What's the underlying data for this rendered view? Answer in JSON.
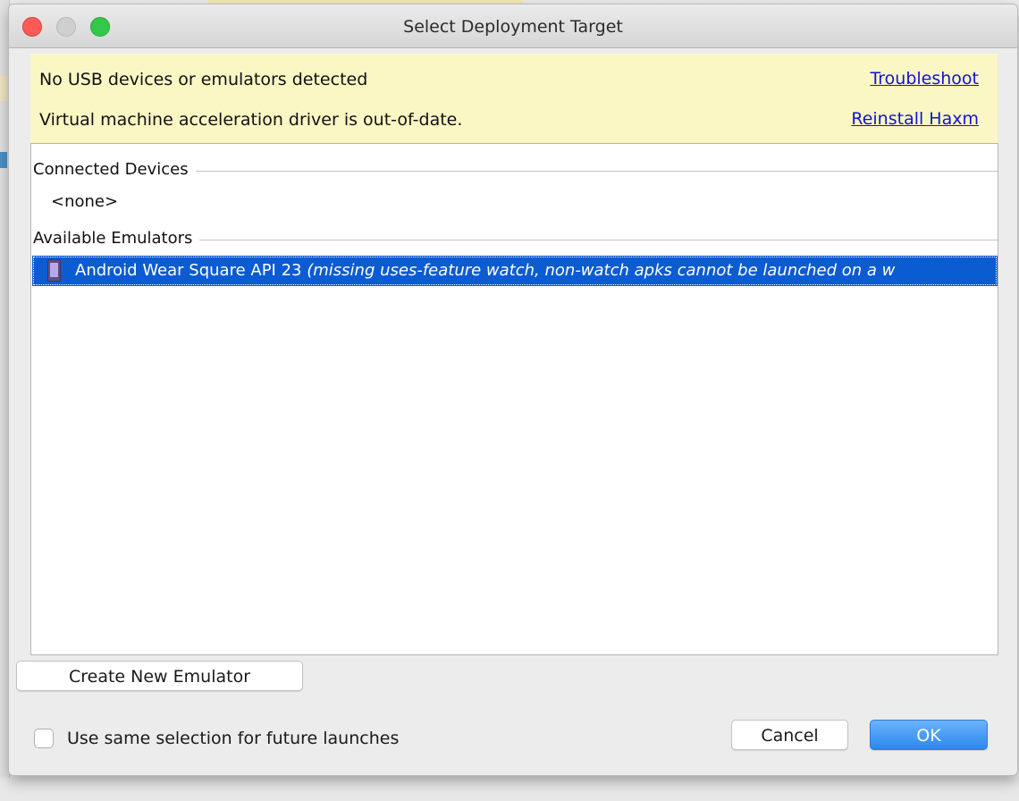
{
  "window": {
    "title": "Select Deployment Target"
  },
  "banner": {
    "messages": [
      {
        "text": "No USB devices or emulators detected",
        "link": "Troubleshoot"
      },
      {
        "text": "Virtual machine acceleration driver is out-of-date.",
        "link": "Reinstall Haxm"
      }
    ]
  },
  "device_list": {
    "groups": [
      {
        "label": "Connected Devices",
        "empty_text": "<none>"
      },
      {
        "label": "Available Emulators",
        "items": [
          {
            "name": "Android Wear Square API 23",
            "note": "(missing uses-feature watch, non-watch apks cannot be launched on a w",
            "icon": "watch-device-icon",
            "selected": true
          }
        ]
      }
    ]
  },
  "buttons": {
    "create": "Create New Emulator",
    "cancel": "Cancel",
    "ok": "OK"
  },
  "checkbox": {
    "label": "Use same selection for future launches",
    "checked": false
  },
  "colors": {
    "banner_bg": "#faf7c4",
    "link": "#1212d8",
    "selection": "#0b5bd3",
    "ok_button": "#2c87f0"
  }
}
